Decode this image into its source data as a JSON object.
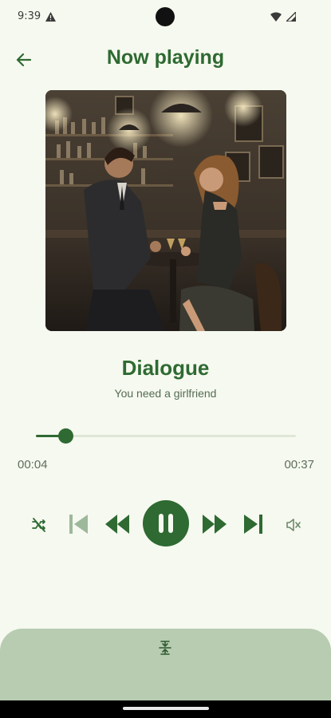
{
  "status_bar": {
    "time": "9:39"
  },
  "header": {
    "title": "Now playing"
  },
  "track": {
    "title": "Dialogue",
    "subtitle": "You need a girlfriend",
    "elapsed": "00:04",
    "total": "00:37",
    "progress_fraction": 0.115
  },
  "icons": {
    "back": "arrow-left-icon",
    "shuffle": "shuffle-off-icon",
    "previous": "skip-previous-icon",
    "rewind": "rewind-icon",
    "pause": "pause-icon",
    "forward": "fast-forward-icon",
    "next": "skip-next-icon",
    "volume": "volume-mute-icon",
    "sheet": "expand-handle-icon"
  },
  "colors": {
    "accent": "#2e6a32",
    "background": "#f6f9ef",
    "sheet": "#b7ccb1"
  }
}
